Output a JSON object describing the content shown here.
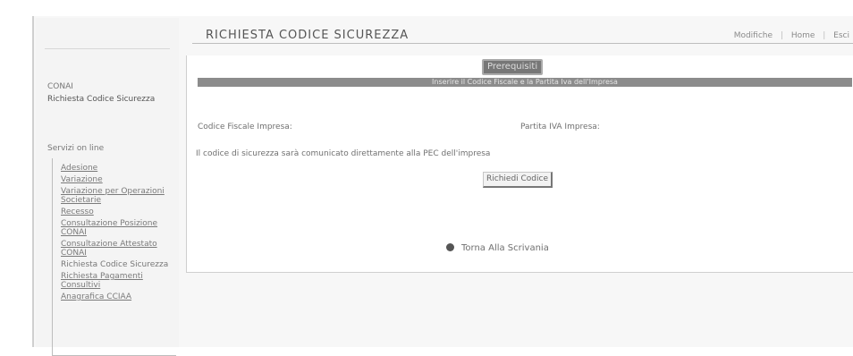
{
  "sidebar": {
    "service": "CONAI",
    "current_page": "Richiesta Codice Sicurezza",
    "section_title": "Servizi on line",
    "links": [
      "Adesione",
      "Variazione",
      "Variazione per Operazioni Societarie",
      "Recesso",
      "Consultazione Posizione CONAI",
      "Consultazione Attestato CONAI",
      "Richiesta Codice Sicurezza",
      "Richiesta Pagamenti Consultivi",
      "Anagrafica CCIAA"
    ]
  },
  "header": {
    "title": "RICHIESTA CODICE SICUREZZA",
    "top_links": [
      "Modifiche",
      "Home",
      "Esci"
    ]
  },
  "content": {
    "prerequisites_button": "Prerequisiti",
    "instructions": "Inserire il Codice Fiscale e la Partita Iva dell'Impresa",
    "codice_fiscale_label": "Codice Fiscale Impresa:",
    "partita_iva_label": "Partita IVA Impresa:",
    "notice": "Il codice di sicurezza sarà comunicato direttamente alla PEC dell'impresa",
    "request_button": "Richiedi Codice",
    "back_link": "Torna Alla Scrivania"
  }
}
